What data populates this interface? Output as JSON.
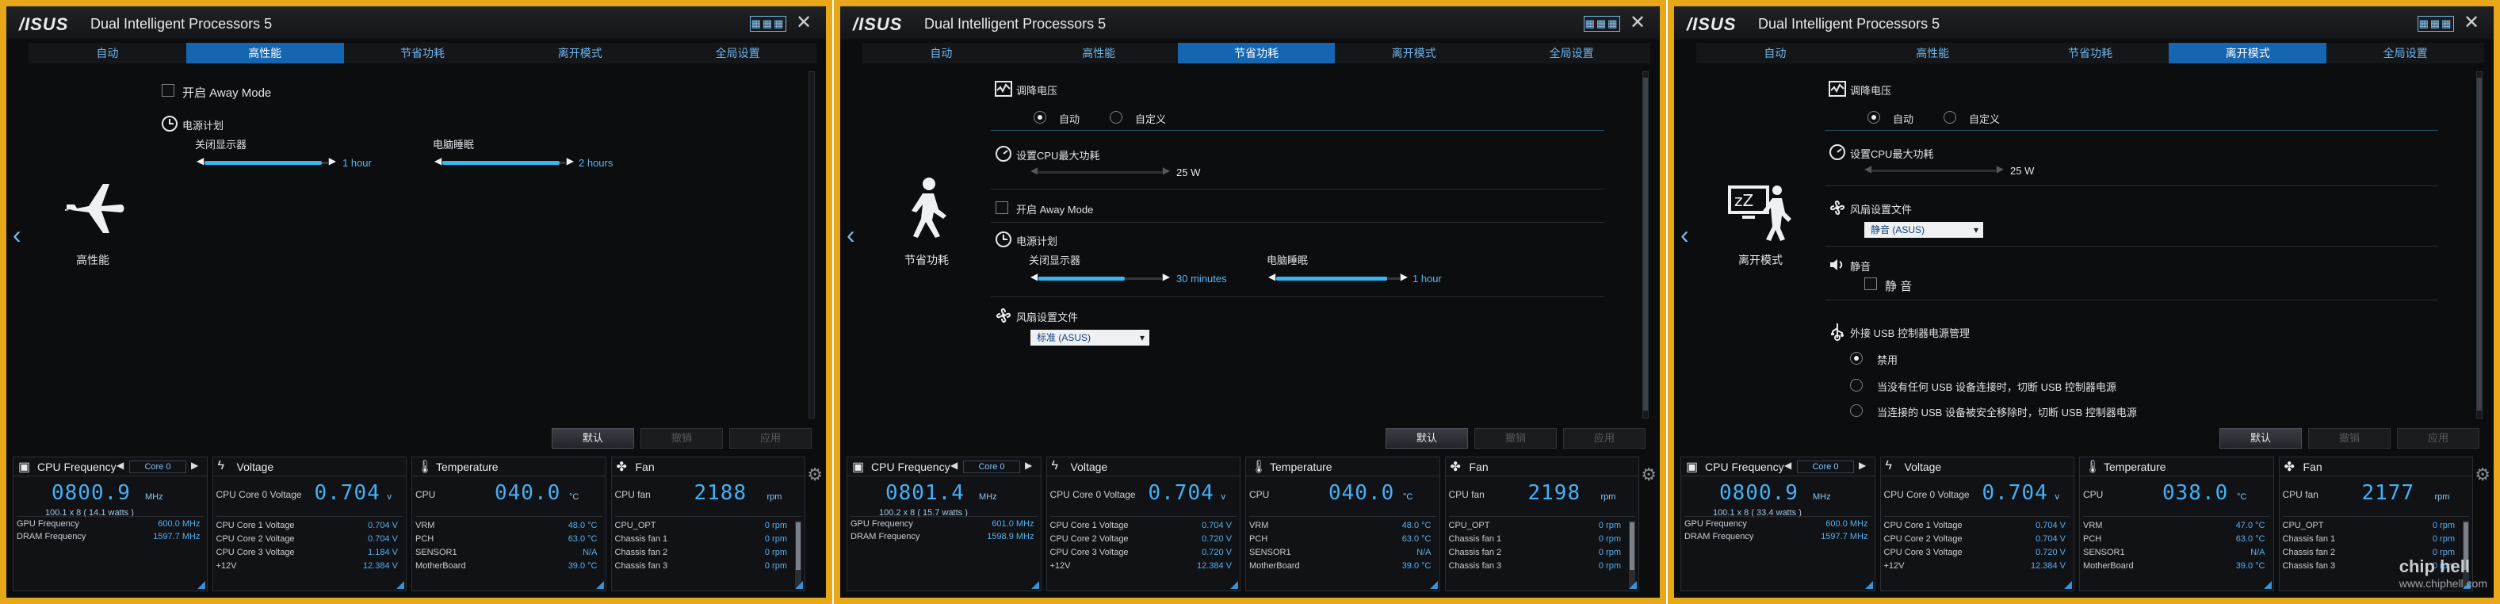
{
  "app": {
    "logo": "/ISUS",
    "title": "Dual Intelligent Processors 5",
    "grid_label": "▦▦▦",
    "close_label": "✕"
  },
  "tabs": [
    "自动",
    "高性能",
    "节省功耗",
    "离开模式",
    "全局设置"
  ],
  "windows": [
    {
      "active_tab": "高性能",
      "mode_label": "高性能",
      "mode_icon": "airplane-icon",
      "away": {
        "label": "开启 Away Mode"
      },
      "power_plan": {
        "label": "电源计划",
        "display_off_label": "关闭显示器",
        "display_off_value": "1 hour",
        "display_off_fraction": 0.95,
        "sleep_label": "电脑睡眠",
        "sleep_value": "2 hours",
        "sleep_fraction": 0.95
      }
    },
    {
      "active_tab": "节省功耗",
      "mode_label": "节省功耗",
      "mode_icon": "walking-person-icon",
      "voltage": {
        "label": "调降电压",
        "opt_auto": "自动",
        "opt_custom": "自定义",
        "selected": "自动"
      },
      "cpu_power": {
        "label": "设置CPU最大功耗",
        "value": "25 W"
      },
      "away": {
        "label": "开启 Away Mode"
      },
      "power_plan": {
        "label": "电源计划",
        "display_off_label": "关闭显示器",
        "display_off_value": "30 minutes",
        "display_off_fraction": 0.7,
        "sleep_label": "电脑睡眠",
        "sleep_value": "1 hour",
        "sleep_fraction": 0.9
      },
      "fan_profile": {
        "label": "风扇设置文件",
        "value": "标准 (ASUS)"
      }
    },
    {
      "active_tab": "离开模式",
      "mode_label": "离开模式",
      "mode_icon": "zzz-sleep-icon",
      "voltage": {
        "label": "调降电压",
        "opt_auto": "自动",
        "opt_custom": "自定义",
        "selected": "自动"
      },
      "cpu_power": {
        "label": "设置CPU最大功耗",
        "value": "25 W"
      },
      "fan_profile": {
        "label": "风扇设置文件",
        "value": "静音 (ASUS)"
      },
      "mute": {
        "label": "静音",
        "check_label": "静 音"
      },
      "usb": {
        "label": "外接 USB 控制器电源管理",
        "options": [
          "禁用",
          "当没有任何 USB 设备连接时，切断 USB 控制器电源",
          "当连接的 USB 设备被安全移除时，切断 USB 控制器电源"
        ],
        "selected": 0
      }
    }
  ],
  "buttons": {
    "default": "默认",
    "undo": "撤销",
    "apply": "应用"
  },
  "monitor": [
    {
      "cpu_freq_title": "CPU Frequency",
      "core_label": "Core 0",
      "big_value": "0800.9",
      "unit": "MHz",
      "sub": "100.1  x  8   ( 14.1   watts )",
      "gpu_label": "GPU Frequency",
      "gpu_value": "600.0  MHz",
      "dram_label": "DRAM Frequency",
      "dram_value": "1597.7  MHz",
      "voltage_title": "Voltage",
      "v0_label": "CPU Core 0 Voltage",
      "v0_value": "0.704",
      "v_rows": [
        [
          "CPU Core 1 Voltage",
          "0.704  V"
        ],
        [
          "CPU Core 2 Voltage",
          "0.704  V"
        ],
        [
          "CPU Core 3 Voltage",
          "1.184  V"
        ],
        [
          "+12V",
          "12.384  V"
        ]
      ],
      "temp_title": "Temperature",
      "cpu_temp_label": "CPU",
      "cpu_temp": "040.0",
      "temp_unit": "°C",
      "t_rows": [
        [
          "VRM",
          "48.0 °C"
        ],
        [
          "PCH",
          "63.0 °C"
        ],
        [
          "SENSOR1",
          "N/A"
        ],
        [
          "MotherBoard",
          "39.0 °C"
        ]
      ],
      "fan_title": "Fan",
      "cpu_fan_label": "CPU fan",
      "cpu_fan": "2188",
      "fan_unit": "rpm",
      "f_rows": [
        [
          "CPU_OPT",
          "0  rpm"
        ],
        [
          "Chassis fan 1",
          "0  rpm"
        ],
        [
          "Chassis fan 2",
          "0  rpm"
        ],
        [
          "Chassis fan 3",
          "0  rpm"
        ]
      ]
    },
    {
      "cpu_freq_title": "CPU Frequency",
      "core_label": "Core 0",
      "big_value": "0801.4",
      "unit": "MHz",
      "sub": "100.2  x  8   ( 15.7   watts )",
      "gpu_label": "GPU Frequency",
      "gpu_value": "601.0  MHz",
      "dram_label": "DRAM Frequency",
      "dram_value": "1598.9  MHz",
      "voltage_title": "Voltage",
      "v0_label": "CPU Core 0 Voltage",
      "v0_value": "0.704",
      "v_rows": [
        [
          "CPU Core 1 Voltage",
          "0.704  V"
        ],
        [
          "CPU Core 2 Voltage",
          "0.720  V"
        ],
        [
          "CPU Core 3 Voltage",
          "0.720  V"
        ],
        [
          "+12V",
          "12.384  V"
        ]
      ],
      "temp_title": "Temperature",
      "cpu_temp_label": "CPU",
      "cpu_temp": "040.0",
      "temp_unit": "°C",
      "t_rows": [
        [
          "VRM",
          "48.0 °C"
        ],
        [
          "PCH",
          "63.0 °C"
        ],
        [
          "SENSOR1",
          "N/A"
        ],
        [
          "MotherBoard",
          "39.0 °C"
        ]
      ],
      "fan_title": "Fan",
      "cpu_fan_label": "CPU fan",
      "cpu_fan": "2198",
      "fan_unit": "rpm",
      "f_rows": [
        [
          "CPU_OPT",
          "0  rpm"
        ],
        [
          "Chassis fan 1",
          "0  rpm"
        ],
        [
          "Chassis fan 2",
          "0  rpm"
        ],
        [
          "Chassis fan 3",
          "0  rpm"
        ]
      ]
    },
    {
      "cpu_freq_title": "CPU Frequency",
      "core_label": "Core 0",
      "big_value": "0800.9",
      "unit": "MHz",
      "sub": "100.1  x  8   ( 33.4   watts )",
      "gpu_label": "GPU Frequency",
      "gpu_value": "600.0  MHz",
      "dram_label": "DRAM Frequency",
      "dram_value": "1597.7  MHz",
      "voltage_title": "Voltage",
      "v0_label": "CPU Core 0 Voltage",
      "v0_value": "0.704",
      "v_rows": [
        [
          "CPU Core 1 Voltage",
          "0.704  V"
        ],
        [
          "CPU Core 2 Voltage",
          "0.704  V"
        ],
        [
          "CPU Core 3 Voltage",
          "0.720  V"
        ],
        [
          "+12V",
          "12.384  V"
        ]
      ],
      "temp_title": "Temperature",
      "cpu_temp_label": "CPU",
      "cpu_temp": "038.0",
      "temp_unit": "°C",
      "t_rows": [
        [
          "VRM",
          "47.0 °C"
        ],
        [
          "PCH",
          "63.0 °C"
        ],
        [
          "SENSOR1",
          "N/A"
        ],
        [
          "MotherBoard",
          "39.0 °C"
        ]
      ],
      "fan_title": "Fan",
      "cpu_fan_label": "CPU fan",
      "cpu_fan": "2177",
      "fan_unit": "rpm",
      "f_rows": [
        [
          "CPU_OPT",
          "0  rpm"
        ],
        [
          "Chassis fan 1",
          "0  rpm"
        ],
        [
          "Chassis fan 2",
          "0  rpm"
        ],
        [
          "Chassis fan 3",
          "0  rpm"
        ]
      ]
    }
  ],
  "watermark": "www.chiphell.com",
  "watermark_logo": "chip hell",
  "colors": {
    "frame": "#e8a718",
    "active_tab": "#1565b0",
    "digits": "#46b0f4"
  }
}
